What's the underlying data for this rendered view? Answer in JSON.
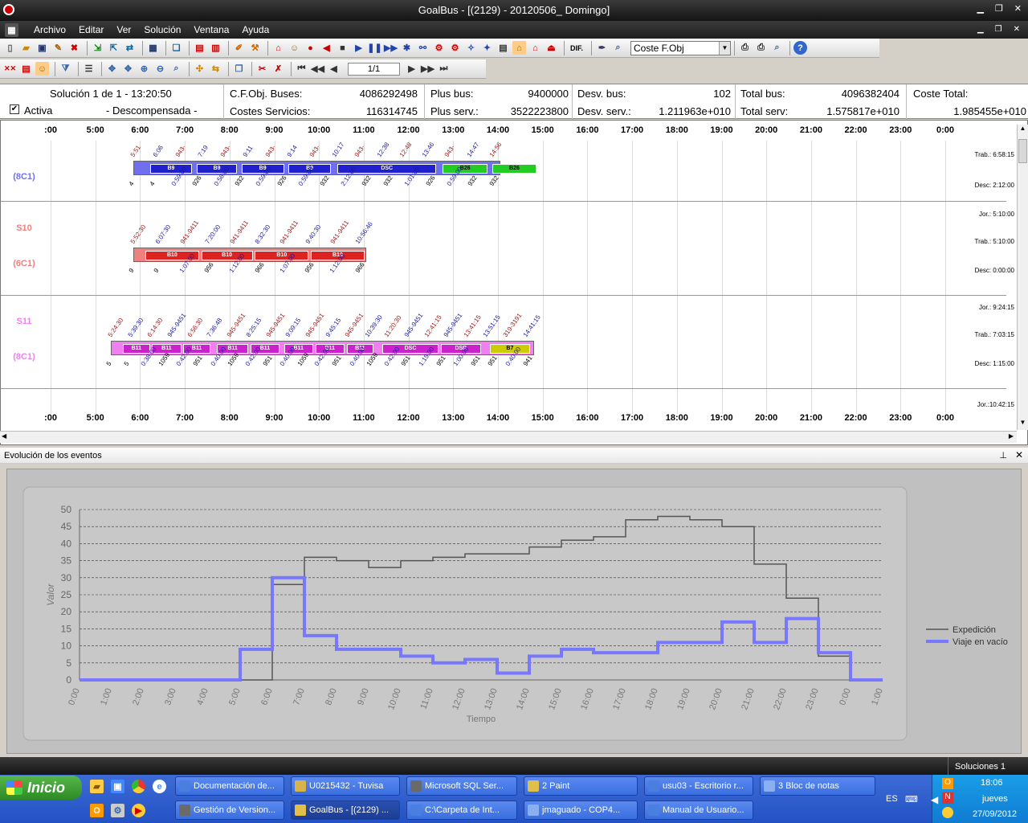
{
  "window": {
    "title": "GoalBus - [(2129) - 20120506_ Domingo]"
  },
  "menu": [
    "Archivo",
    "Editar",
    "Ver",
    "Solución",
    "Ventana",
    "Ayuda"
  ],
  "toolbar": {
    "cost_combo": "Coste F.Obj",
    "dif_label": "DIF.",
    "page": "1/1"
  },
  "summary": {
    "solution": "Solución 1 de 1 - 13:20:50",
    "active_label": "Activa",
    "state": "- Descompensada -",
    "cfobj_label": "C.F.Obj. Buses:",
    "cfobj_value": "4086292498",
    "costserv_label": "Costes Servicios:",
    "costserv_value": "116314745",
    "plusbus_label": "Plus bus:",
    "plusbus_value": "9400000",
    "plusserv_label": "Plus serv.:",
    "plusserv_value": "3522223800",
    "desvbus_label": "Desv. bus:",
    "desvbus_value": "102",
    "desvserv_label": "Desv. serv.:",
    "desvserv_value": "1.211963e+010",
    "totalbus_label": "Total bus:",
    "totalbus_value": "4096382404",
    "totalserv_label": "Total serv:",
    "totalserv_value": "1.575817e+010",
    "costetotal_label": "Coste Total:",
    "costetotal_value": "1.985455e+010"
  },
  "hours": [
    ":00",
    "5:00",
    "6:00",
    "7:00",
    "8:00",
    "9:00",
    "10:00",
    "11:00",
    "12:00",
    "13:00",
    "14:00",
    "15:00",
    "16:00",
    "17:00",
    "18:00",
    "19:00",
    "20:00",
    "21:00",
    "22:00",
    "23:00",
    "0:00"
  ],
  "rows": [
    {
      "name": "",
      "group": "(8C1)",
      "color": "#7070ee",
      "segcolor": "#2020cc",
      "start": 5.85,
      "end": 14.05,
      "info": [
        "Trab.: 6:58:15",
        "Desc: 2:12:00"
      ],
      "segments": [
        [
          "B9",
          6.2,
          7.15
        ],
        [
          "B9",
          7.25,
          8.15
        ],
        [
          "B9",
          8.25,
          9.2
        ],
        [
          "B9",
          9.3,
          10.25
        ],
        [
          "DSC",
          10.4,
          12.6
        ],
        [
          "B26",
          12.75,
          13.75,
          "#22cc22"
        ],
        [
          "B26",
          13.85,
          14.85,
          "#22cc22"
        ]
      ],
      "top_labels": [
        "5:51",
        "6:06",
        "943-",
        "7:19",
        "943-",
        "9:11",
        "943-",
        "9:14",
        "943-",
        "10:17",
        "943-",
        "12:38",
        "12:48",
        "13:46",
        "943-",
        "14:47",
        "14:56"
      ],
      "bottom_labels": [
        "4",
        "4",
        "0:59:00",
        "926",
        "0:56:00",
        "932",
        "0:59:00",
        "926",
        "0:59:00",
        "932",
        "2:12:00",
        "932",
        "932",
        "1:01:00",
        "926",
        "0:59:00",
        "932",
        "932"
      ]
    },
    {
      "name": "S10",
      "group": "(6C1)",
      "color": "#f08080",
      "segcolor": "#dd2222",
      "start": 5.85,
      "end": 11.05,
      "info": [
        "Jor.: 5:10:00",
        "Trab.: 5:10:00",
        "Desc: 0:00:00"
      ],
      "segments": [
        [
          "B10",
          6.1,
          7.3
        ],
        [
          "B10",
          7.35,
          8.5
        ],
        [
          "B10",
          8.55,
          9.75
        ],
        [
          "B10",
          9.8,
          11.0
        ]
      ],
      "top_labels": [
        "5:52:30",
        "6:07:30",
        "941-9411",
        "7:20:00",
        "941-9411",
        "8:32:30",
        "941-9411",
        "9:40:30",
        "941-9411",
        "10:56:46"
      ],
      "bottom_labels": [
        "9",
        "9",
        "1:07:00",
        "956",
        "1:12:00",
        "966",
        "1:07:00",
        "956",
        "1:12:00",
        "966"
      ]
    },
    {
      "name": "S11",
      "group": "(8C1)",
      "color": "#f080f0",
      "segcolor": "#cc22cc",
      "start": 5.35,
      "end": 14.8,
      "info": [
        "Jor.: 9:24:15",
        "Trab.: 7:03:15",
        "Desc: 1:15:00"
      ],
      "segments": [
        [
          "B11",
          5.6,
          6.2
        ],
        [
          "B11",
          6.25,
          6.9
        ],
        [
          "B11",
          6.95,
          7.55
        ],
        [
          "B11",
          7.7,
          8.4
        ],
        [
          "B11",
          8.45,
          9.1
        ],
        [
          "B11",
          9.2,
          9.85
        ],
        [
          "B11",
          9.9,
          10.55
        ],
        [
          "B11",
          10.6,
          11.2
        ],
        [
          "DSC",
          11.4,
          12.65
        ],
        [
          "DSP",
          12.7,
          13.6
        ],
        [
          "B7",
          13.8,
          14.7,
          "#cccc00"
        ]
      ],
      "top_labels": [
        "5:24:30",
        "5:39:30",
        "6:14:30",
        "945-9451",
        "6:56:30",
        "7:36:48",
        "945-9451",
        "8:25:15",
        "945-9451",
        "9:09:15",
        "945-9451",
        "9:45:15",
        "945-9451",
        "10:39:30",
        "11:20:30",
        "945-9451",
        "12:41:15",
        "945-9451",
        "13:41:15",
        "13:51:15",
        "319-3191",
        "14:41:15"
      ],
      "bottom_labels": [
        "5",
        "5",
        "0:38:00",
        "1059",
        "0:42:00",
        "951",
        "0:40:00",
        "1059",
        "0:42:00",
        "951",
        "0:40:00",
        "1059",
        "0:42:00",
        "951",
        "0:40:00",
        "1059",
        "0:42:00",
        "951",
        "1:15:00",
        "951",
        "1:00:00",
        "951",
        "951",
        "0:40:00",
        "941"
      ]
    }
  ],
  "last_row_info": "Jor.:10:42:15",
  "panel": {
    "title": "Evolución de los eventos"
  },
  "chart_data": {
    "type": "line",
    "xlabel": "Tiempo",
    "ylabel": "Valor",
    "ylim": [
      0,
      50
    ],
    "yticks": [
      0,
      5,
      10,
      15,
      20,
      25,
      30,
      35,
      40,
      45,
      50
    ],
    "categories": [
      "0:00",
      "1:00",
      "2:00",
      "3:00",
      "4:00",
      "5:00",
      "6:00",
      "7:00",
      "8:00",
      "9:00",
      "10:00",
      "11:00",
      "12:00",
      "13:00",
      "14:00",
      "15:00",
      "16:00",
      "17:00",
      "18:00",
      "19:00",
      "20:00",
      "21:00",
      "22:00",
      "23:00",
      "0:00",
      "1:00"
    ],
    "legend": "right",
    "grid": true,
    "series": [
      {
        "name": "Expedición",
        "color": "#555555",
        "width": 1.5,
        "steps": [
          [
            0,
            0
          ],
          [
            5,
            0
          ],
          [
            6,
            28
          ],
          [
            7,
            36
          ],
          [
            8,
            35
          ],
          [
            9,
            33
          ],
          [
            10,
            35
          ],
          [
            11,
            36
          ],
          [
            12,
            37
          ],
          [
            13,
            37
          ],
          [
            14,
            39
          ],
          [
            15,
            41
          ],
          [
            16,
            42
          ],
          [
            17,
            47
          ],
          [
            18,
            48
          ],
          [
            19,
            47
          ],
          [
            20,
            45
          ],
          [
            21,
            34
          ],
          [
            22,
            24
          ],
          [
            23,
            7
          ],
          [
            24,
            0
          ],
          [
            25,
            0
          ]
        ]
      },
      {
        "name": "Viaje en vacío",
        "color": "#7777ff",
        "width": 4,
        "steps": [
          [
            0,
            0
          ],
          [
            5,
            9
          ],
          [
            6,
            30
          ],
          [
            7,
            13
          ],
          [
            8,
            9
          ],
          [
            9,
            9
          ],
          [
            10,
            7
          ],
          [
            11,
            5
          ],
          [
            12,
            6
          ],
          [
            13,
            2
          ],
          [
            14,
            7
          ],
          [
            15,
            9
          ],
          [
            16,
            8
          ],
          [
            17,
            8
          ],
          [
            18,
            11
          ],
          [
            19,
            11
          ],
          [
            20,
            17
          ],
          [
            21,
            11
          ],
          [
            22,
            18
          ],
          [
            23,
            8
          ],
          [
            24,
            0
          ],
          [
            25,
            0
          ]
        ]
      }
    ]
  },
  "statusbar": {
    "right": "Soluciones 1"
  },
  "taskbar": {
    "start": "Inicio",
    "row1": [
      "Documentación de...",
      "U0215432 - Tuvisa",
      "Microsoft SQL Ser...",
      "2 Paint",
      "usu03 - Escritorio r...",
      "3 Bloc de notas"
    ],
    "row2": [
      "Gestión de Version...",
      "GoalBus - [(2129) ...",
      "C:\\Carpeta de Int...",
      "jmaguado - COP4...",
      "Manual de Usuario..."
    ],
    "lang": "ES",
    "time": "18:06",
    "day": "jueves",
    "date": "27/09/2012"
  }
}
